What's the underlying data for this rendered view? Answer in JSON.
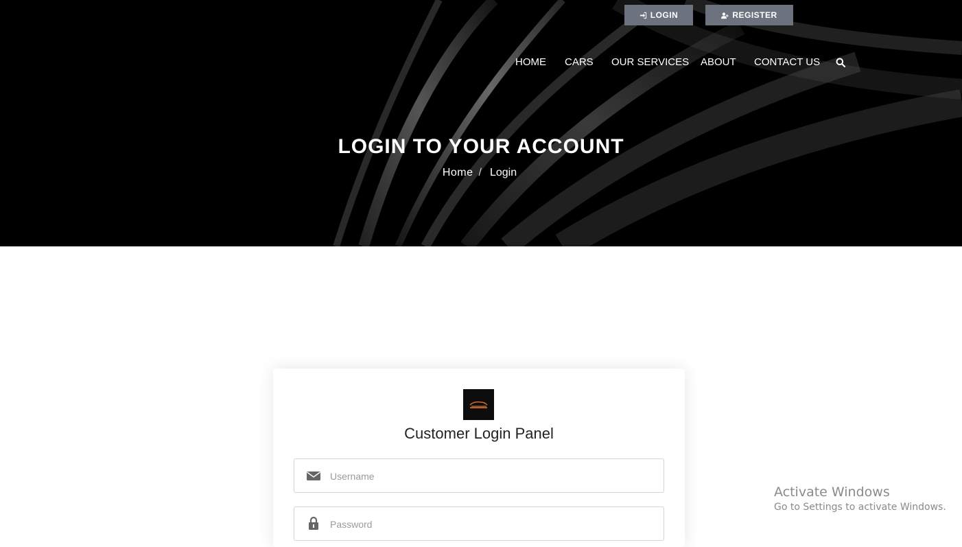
{
  "topbar": {
    "login_label": "LOGIN",
    "register_label": "REGISTER"
  },
  "nav": {
    "items": [
      {
        "label": "HOME"
      },
      {
        "label": "CARS"
      },
      {
        "label": "OUR SERVICES"
      },
      {
        "label": "ABOUT"
      },
      {
        "label": "CONTACT US"
      }
    ],
    "search_icon": "search-icon"
  },
  "hero": {
    "title": "LOGIN TO YOUR ACCOUNT",
    "breadcrumb": {
      "home": "Home",
      "separator": "/",
      "current": "Login"
    }
  },
  "panel": {
    "logo_icon": "car-service-logo",
    "title": "Customer Login Panel",
    "username": {
      "value": "",
      "placeholder": "Username",
      "icon": "envelope-icon"
    },
    "password": {
      "value": "",
      "placeholder": "Password",
      "icon": "lock-icon"
    }
  },
  "watermark": {
    "line1": "Activate Windows",
    "line2": "Go to Settings to activate Windows."
  },
  "colors": {
    "hero_bg": "#000000",
    "topbar_button": "#6c737f",
    "page_bg": "#ffffff"
  }
}
